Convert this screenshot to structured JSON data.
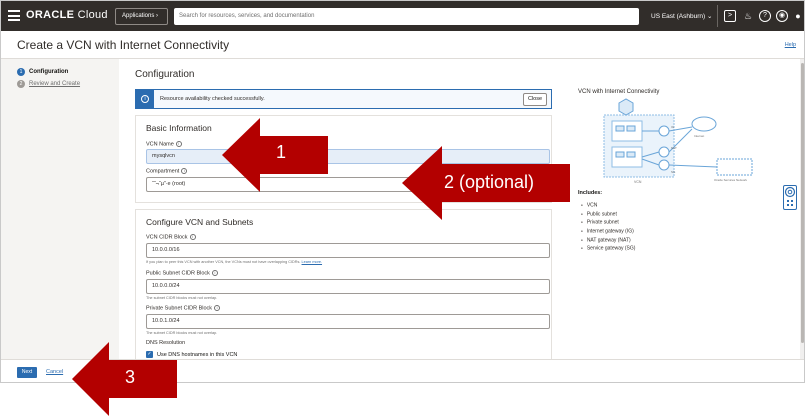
{
  "topbar": {
    "logo_brand": "ORACLE",
    "logo_product": " Cloud",
    "apps_label": "Applications",
    "search_placeholder": "Search for resources, services, and documentation",
    "region_label": "US East (Ashburn)"
  },
  "page": {
    "title": "Create a VCN with Internet Connectivity",
    "help_label": "Help"
  },
  "steps": [
    {
      "num": "1",
      "label": "Configuration"
    },
    {
      "num": "2",
      "label": "Review and Create"
    }
  ],
  "main": {
    "section_title": "Configuration",
    "banner": {
      "message": "Resource availability checked successfully.",
      "close_label": "Close"
    },
    "basic_info": {
      "title": "Basic Information",
      "vcn_name_label": "VCN Name",
      "vcn_name_value": "mysqlvcn",
      "compartment_label": "Compartment",
      "compartment_value": "““¬“µ”·e (root)"
    },
    "vcn_subnets": {
      "title": "Configure VCN and Subnets",
      "vcn_cidr_label": "VCN CIDR Block",
      "vcn_cidr_value": "10.0.0.0/16",
      "vcn_cidr_hint": "If you plan to peer this VCN with another VCN, the VCNs must not have overlapping CIDRs.",
      "vcn_cidr_hint_link": "Learn more.",
      "public_subnet_label": "Public Subnet CIDR Block",
      "public_subnet_value": "10.0.0.0/24",
      "public_subnet_hint": "The subnet CIDR blocks must not overlap.",
      "private_subnet_label": "Private Subnet CIDR Block",
      "private_subnet_value": "10.0.1.0/24",
      "private_subnet_hint": "The subnet CIDR blocks must not overlap.",
      "dns_label": "DNS Resolution",
      "dns_checkbox_label": "Use DNS hostnames in this VCN"
    }
  },
  "right_panel": {
    "diagram_title": "VCN with Internet Connectivity",
    "diagram_labels": {
      "vcn": "VCN",
      "internet": "Internet",
      "oracle_services": "Oracle Services Network",
      "ig": "IG",
      "nat": "NAT",
      "sg": "SG"
    },
    "includes_title": "Includes:",
    "includes": [
      "VCN",
      "Public subnet",
      "Private subnet",
      "Internet gateway (IG)",
      "NAT gateway (NAT)",
      "Service gateway (SG)"
    ]
  },
  "footer": {
    "next_label": "Next",
    "cancel_label": "Cancel"
  },
  "annotations": [
    {
      "label": "1"
    },
    {
      "label": "2 (optional)"
    },
    {
      "label": "3"
    }
  ],
  "colors": {
    "accent": "#2b6cb0",
    "topbar": "#312d2a",
    "annotation_arrow": "#b30000"
  }
}
